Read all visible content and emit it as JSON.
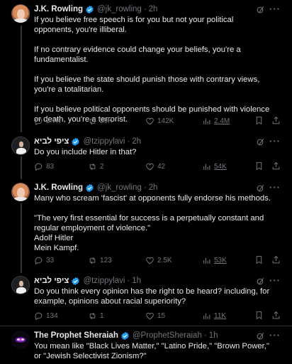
{
  "colors": {
    "background": "#000000",
    "text": "#e7e9ea",
    "muted": "#71767b",
    "verified": "#1d9bf0",
    "divider": "#2f3336"
  },
  "tweets": [
    {
      "name": "J.K. Rowling",
      "handle": "@jk_rowling",
      "time": "2h",
      "avatar": "jk",
      "text": "If you believe free speech is for you but not your political opponents, you're illiberal.\n\nIf no contrary evidence could change your beliefs, you're a fundamentalist.\n\nIf you believe the state should punish those with contrary views, you're a totalitarian.\n\nIf you believe political opponents should be punished with violence or death, you're a terrorist.",
      "replies": "2.7K",
      "reposts": "29K",
      "likes": "142K",
      "views": "2.4M"
    },
    {
      "name": "ציפי לביא",
      "handle": "@tzippylavi",
      "time": "2h",
      "avatar": "tz",
      "text": "Do you include Hitler in that?",
      "replies": "83",
      "reposts": "2",
      "likes": "42",
      "views": "54K"
    },
    {
      "name": "J.K. Rowling",
      "handle": "@jk_rowling",
      "time": "2h",
      "avatar": "jk",
      "text": "Many who scream 'fascist' at opponents fully endorse his methods.\n\n\"The very first essential for success is a perpetually constant and regular employment of violence.\"\nAdolf Hitler\nMein Kampf.",
      "replies": "33",
      "reposts": "123",
      "likes": "2.5K",
      "views": "53K"
    },
    {
      "name": "ציפי לביא",
      "handle": "@tzippylavi",
      "time": "1h",
      "avatar": "tz",
      "text": "Do you think every opinion has the right to be heard? including, for example, opinions about racial superiority?",
      "replies": "134",
      "reposts": "1",
      "likes": "15",
      "views": "11K"
    },
    {
      "name": "The Prophet Sheraiah",
      "handle": "@ProphetSheraiah",
      "time": "1h",
      "avatar": "ps",
      "text": "You mean like \"Black Lives Matter,\" \"Latino Pride,\" \"Brown Power,\" or \"Jewish Selectivist Zionism?\""
    }
  ]
}
